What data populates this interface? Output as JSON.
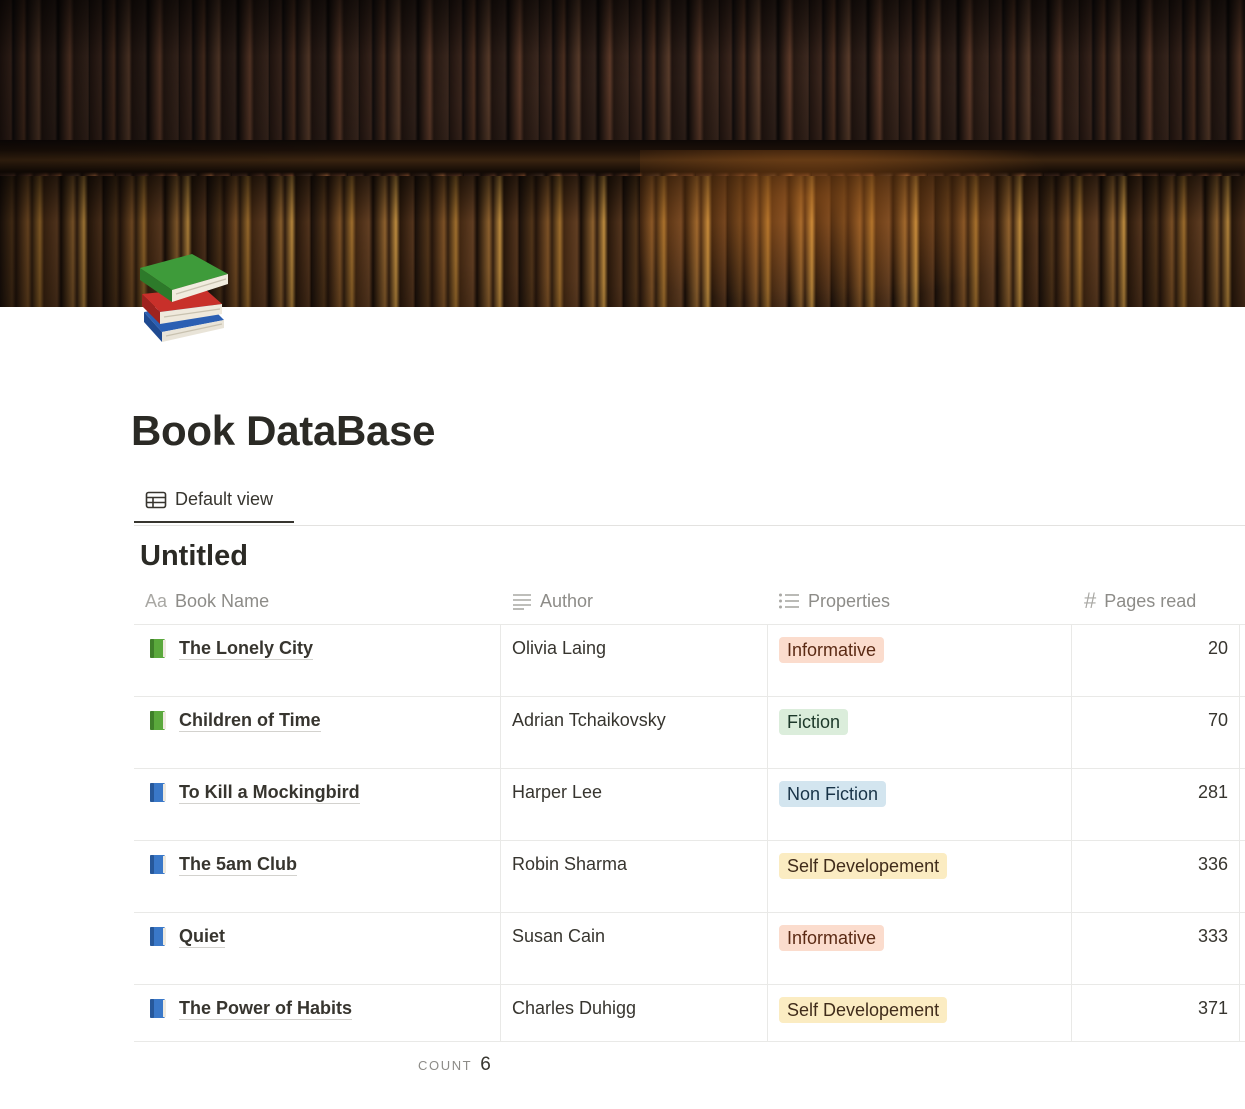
{
  "page": {
    "title": "Book DataBase",
    "cover": "bookshelf-cover-image",
    "icon": "books-stack-icon"
  },
  "views": {
    "active_tab": "Default view",
    "tab_icon": "table-icon"
  },
  "database": {
    "title": "Untitled",
    "columns": [
      {
        "icon": "Aa",
        "label": "Book Name"
      },
      {
        "icon": "text-lines-icon",
        "label": "Author"
      },
      {
        "icon": "bullet-list-icon",
        "label": "Properties"
      },
      {
        "icon": "#",
        "label": "Pages read"
      }
    ],
    "rows": [
      {
        "icon": "green-book-icon",
        "name": "The Lonely City",
        "author": "Olivia Laing",
        "property": "Informative",
        "tag_bg": "#fbdccd",
        "tag_fg": "#5b2a14",
        "pages": "20"
      },
      {
        "icon": "green-book-icon",
        "name": "Children of Time",
        "author": "Adrian Tchaikovsky",
        "property": "Fiction",
        "tag_bg": "#dbeddb",
        "tag_fg": "#1c3829",
        "pages": "70"
      },
      {
        "icon": "blue-book-icon",
        "name": "To Kill a Mockingbird",
        "author": "Harper Lee",
        "property": "Non Fiction",
        "tag_bg": "#d3e5ef",
        "tag_fg": "#183347",
        "pages": "281"
      },
      {
        "icon": "blue-book-icon",
        "name": "The 5am Club",
        "author": "Robin Sharma",
        "property": "Self Developement",
        "tag_bg": "#fbecc2",
        "tag_fg": "#402c1b",
        "pages": "336"
      },
      {
        "icon": "blue-book-icon",
        "name": "Quiet",
        "author": "Susan Cain",
        "property": "Informative",
        "tag_bg": "#fbdccd",
        "tag_fg": "#5b2a14",
        "pages": "333"
      },
      {
        "icon": "blue-book-icon",
        "name": "The Power of Habits",
        "author": "Charles Duhigg",
        "property": "Self Developement",
        "tag_bg": "#fbecc2",
        "tag_fg": "#402c1b",
        "pages": "371"
      }
    ],
    "footer": {
      "count_label": "COUNT",
      "count_value": "6"
    }
  }
}
